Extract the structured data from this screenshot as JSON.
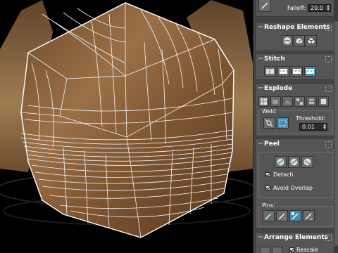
{
  "viewport": {
    "name": "uv-editor-viewport",
    "colors": {
      "texture": "#8a6138",
      "wireframe": "#ffffff",
      "background": "#000000"
    }
  },
  "panel": {
    "softselect": {
      "falloff_label": "Falloff:",
      "falloff_value": "20.0"
    },
    "reshape": {
      "title": "Reshape Elements"
    },
    "stitch": {
      "title": "Stitch"
    },
    "explode": {
      "title": "Explode",
      "weld_label": "Weld",
      "threshold_label": "Threshold:",
      "threshold_value": "0.01"
    },
    "peel": {
      "title": "Peel",
      "detach_label": "Detach",
      "avoid_overlap_label": "Avoid Overlap",
      "pins_label": "Pins:"
    },
    "arrange": {
      "title": "Arrange Elements",
      "rescale_label": "Rescale"
    },
    "accent": "#3e8fb0"
  }
}
